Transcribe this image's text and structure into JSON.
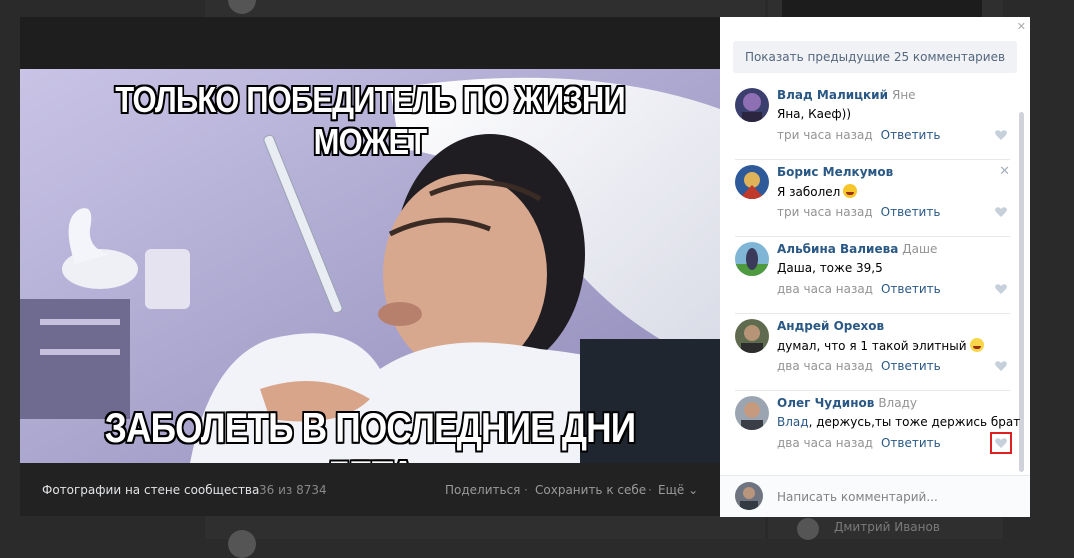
{
  "background": {
    "names": [
      "Дмитрий Иванов"
    ]
  },
  "viewer": {
    "meme_top": "ТОЛЬКО ПОБЕДИТЕЛЬ ПО ЖИЗНИ МОЖЕТ",
    "meme_bottom": "ЗАБОЛЕТЬ В ПОСЛЕДНИЕ ДНИ ЛЕТА",
    "album_title": "Фотографии на стене сообщества",
    "album_count": "36 из 8734",
    "actions": {
      "share": "Поделиться",
      "sep": "·",
      "save": "Сохранить к себе",
      "more": "Ещё ⌄"
    }
  },
  "comments_panel": {
    "show_previous": "Показать предыдущие 25 комментариев",
    "comments": [
      {
        "author": "Влад Малицкий",
        "reply_to": "Яне",
        "text": "Яна, Каеф))",
        "time": "три часа назад",
        "reply": "Ответить"
      },
      {
        "author": "Борис Мелкумов",
        "reply_to": "",
        "text": "Я заболел",
        "time": "три часа назад",
        "reply": "Ответить"
      },
      {
        "author": "Альбина Валиева",
        "reply_to": "Даше",
        "text": "Даша, тоже 39,5",
        "time": "два часа назад",
        "reply": "Ответить"
      },
      {
        "author": "Андрей Орехов",
        "reply_to": "",
        "text": "думал, что я 1 такой элитный",
        "time": "два часа назад",
        "reply": "Ответить"
      },
      {
        "author": "Олег Чудинов",
        "reply_to": "Владу",
        "mention": "Влад",
        "text": ", держусь,ты тоже держись брат",
        "time": "два часа назад",
        "reply": "Ответить"
      }
    ],
    "input_placeholder": "Написать комментарий..."
  },
  "colors": {
    "link": "#2a5885",
    "highlight": "#e02020"
  }
}
